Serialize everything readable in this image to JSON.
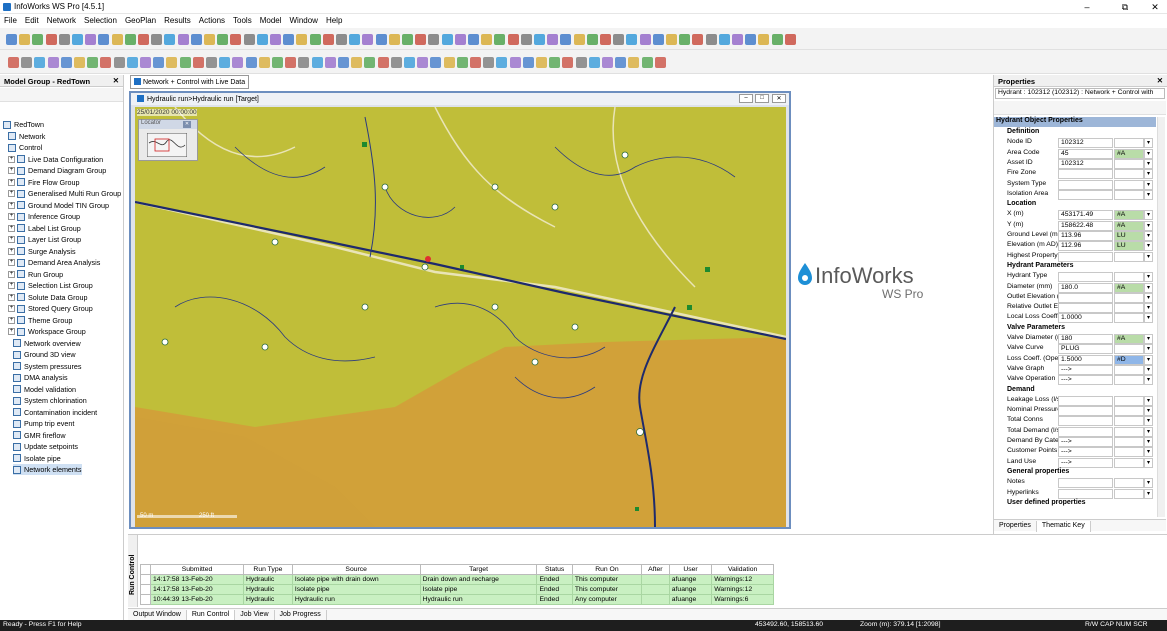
{
  "app": {
    "title": "InfoWorks WS Pro [4.5.1]",
    "controls": [
      "–",
      "⧉",
      "✕"
    ]
  },
  "menu": [
    "File",
    "Edit",
    "Network",
    "Selection",
    "GeoPlan",
    "Results",
    "Actions",
    "Tools",
    "Model",
    "Window",
    "Help"
  ],
  "model_group": {
    "title": "Model Group - RedTown",
    "close": "✕",
    "items": [
      {
        "label": "RedTown",
        "level": 0
      },
      {
        "label": "Network",
        "level": 1
      },
      {
        "label": "Control",
        "level": 1
      },
      {
        "label": "Live Data Configuration",
        "level": 1
      },
      {
        "label": "Demand Diagram Group",
        "level": 1
      },
      {
        "label": "Fire Flow Group",
        "level": 1
      },
      {
        "label": "Generalised Multi Run Group",
        "level": 1
      },
      {
        "label": "Ground Model TIN Group",
        "level": 1
      },
      {
        "label": "Inference Group",
        "level": 1
      },
      {
        "label": "Label List Group",
        "level": 1
      },
      {
        "label": "Layer List Group",
        "level": 1
      },
      {
        "label": "Surge Analysis",
        "level": 1
      },
      {
        "label": "Demand Area Analysis",
        "level": 1
      },
      {
        "label": "Run Group",
        "level": 1
      },
      {
        "label": "Selection List Group",
        "level": 1
      },
      {
        "label": "Solute Data Group",
        "level": 1
      },
      {
        "label": "Stored Query Group",
        "level": 1
      },
      {
        "label": "Theme Group",
        "level": 1
      },
      {
        "label": "Workspace Group",
        "level": 1
      },
      {
        "label": "Network overview",
        "level": 2
      },
      {
        "label": "Ground 3D view",
        "level": 2
      },
      {
        "label": "System pressures",
        "level": 2
      },
      {
        "label": "DMA analysis",
        "level": 2
      },
      {
        "label": "Model validation",
        "level": 2
      },
      {
        "label": "System chlorination",
        "level": 2
      },
      {
        "label": "Contamination incident",
        "level": 2
      },
      {
        "label": "Pump trip event",
        "level": 2
      },
      {
        "label": "GMR fireflow",
        "level": 2
      },
      {
        "label": "Update setpoints",
        "level": 2
      },
      {
        "label": "Isolate pipe",
        "level": 2
      },
      {
        "label": "Network elements",
        "level": 2
      }
    ]
  },
  "mdi": {
    "tab_label": "Network + Control with Live Data",
    "map_title": "Hydraulic run>Hydraulic run  [Target]",
    "timestamp": "25/01/2020 00:00:00",
    "locator_label": "Locator",
    "scale_labels": [
      "50 m",
      "250 ft"
    ]
  },
  "brand": {
    "name": "InfoWorks",
    "sub": "WS Pro"
  },
  "properties": {
    "title": "Properties",
    "object_header": "Hydrant : 102312 (102312) : Network + Control with",
    "grid_title": "Hydrant Object Properties",
    "sections": [
      {
        "name": "Definition",
        "rows": [
          {
            "label": "Node ID",
            "value": "102312",
            "flag": ""
          },
          {
            "label": "Area Code",
            "value": "45",
            "flag": "#A"
          },
          {
            "label": "Asset ID",
            "value": "102312",
            "flag": ""
          },
          {
            "label": "Fire Zone",
            "value": "",
            "flag": ""
          },
          {
            "label": "System Type",
            "value": "",
            "flag": ""
          },
          {
            "label": "Isolation Area",
            "value": "",
            "flag": ""
          }
        ]
      },
      {
        "name": "Location",
        "rows": [
          {
            "label": "X (m)",
            "value": "453171.49",
            "flag": "#A"
          },
          {
            "label": "Y (m)",
            "value": "158622.48",
            "flag": "#A"
          },
          {
            "label": "Ground Level (m A",
            "value": "113.96",
            "flag": "LU"
          },
          {
            "label": "Elevation (m AD)",
            "value": "112.96",
            "flag": "LU"
          },
          {
            "label": "Highest Property",
            "value": "",
            "flag": ""
          }
        ]
      },
      {
        "name": "Hydrant Parameters",
        "rows": [
          {
            "label": "Hydrant Type",
            "value": "",
            "flag": ""
          },
          {
            "label": "Diameter (mm)",
            "value": "180.0",
            "flag": "#A"
          },
          {
            "label": "Outlet Elevation (",
            "value": "",
            "flag": ""
          },
          {
            "label": "Relative Outlet El",
            "value": "",
            "flag": ""
          },
          {
            "label": "Local Loss Coeffic",
            "value": "1.0000",
            "flag": ""
          }
        ]
      },
      {
        "name": "Valve Parameters",
        "rows": [
          {
            "label": "Valve Diameter (m",
            "value": "180",
            "flag": "#A"
          },
          {
            "label": "Valve Curve",
            "value": "PLUG",
            "flag": ""
          },
          {
            "label": "Loss Coeff. (Open",
            "value": "1.5000",
            "flag": "#D"
          },
          {
            "label": "Valve Graph",
            "value": "--->",
            "flag": ""
          },
          {
            "label": "Valve Operation",
            "value": "--->",
            "flag": ""
          }
        ]
      },
      {
        "name": "Demand",
        "rows": [
          {
            "label": "Leakage Loss (l/s",
            "value": "",
            "flag": ""
          },
          {
            "label": "Nominal Pressure",
            "value": "",
            "flag": ""
          },
          {
            "label": "Total Conns",
            "value": "",
            "flag": ""
          },
          {
            "label": "Total Demand (l/s",
            "value": "",
            "flag": ""
          },
          {
            "label": "Demand By Categ",
            "value": "--->",
            "flag": ""
          },
          {
            "label": "Customer Points",
            "value": "--->",
            "flag": ""
          },
          {
            "label": "Land Use",
            "value": "--->",
            "flag": ""
          }
        ]
      },
      {
        "name": "General properties",
        "rows": [
          {
            "label": "Notes",
            "value": "",
            "flag": ""
          },
          {
            "label": "Hyperlinks",
            "value": "",
            "flag": ""
          }
        ]
      },
      {
        "name": "User defined properties",
        "rows": []
      }
    ],
    "tabs": [
      "Properties",
      "Thematic Key"
    ]
  },
  "run_control": {
    "side_label": "Run Control",
    "columns": [
      "Submitted",
      "Run Type",
      "Source",
      "Target",
      "Status",
      "Run On",
      "After",
      "User",
      "Validation"
    ],
    "rows": [
      [
        "14:17:58 13-Feb-20",
        "Hydraulic",
        "Isolate pipe with drain down",
        "Drain down and recharge",
        "Ended",
        "This computer",
        "",
        "afuange",
        "Warnings:12"
      ],
      [
        "14:17:58 13-Feb-20",
        "Hydraulic",
        "Isolate pipe",
        "Isolate pipe",
        "Ended",
        "This computer",
        "",
        "afuange",
        "Warnings:12"
      ],
      [
        "10:44:39 13-Feb-20",
        "Hydraulic",
        "Hydraulic run",
        "Hydraulic run",
        "Ended",
        "Any computer",
        "",
        "afuange",
        "Warnings:6"
      ]
    ],
    "tabs": [
      "Output Window",
      "Run Control",
      "Job View",
      "Job Progress"
    ]
  },
  "status": {
    "left": "Ready - Press F1 for Help",
    "coords": "453492.60, 158513.60",
    "zoom": "Zoom (m): 379.14 [1:2098]",
    "flags": "R/W  CAP  NUM  SCR"
  },
  "colors": {
    "accent": "#1d6fc4",
    "row_green": "#c9f0c2",
    "zone_yellow": "#c9c430",
    "zone_orange": "#d9a04a"
  }
}
